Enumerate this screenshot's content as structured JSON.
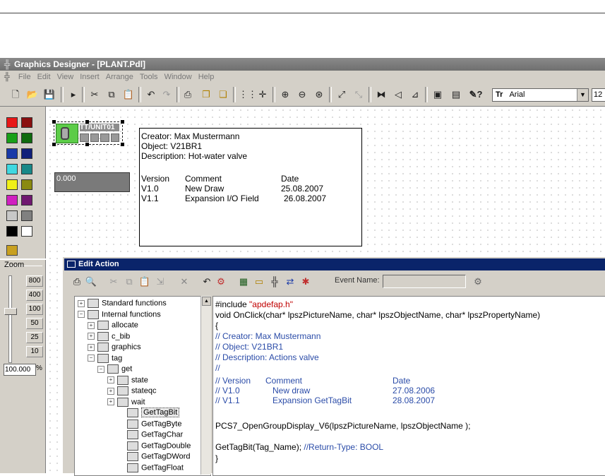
{
  "app": {
    "title": "Graphics Designer - [PLANT.Pdl]"
  },
  "menu": [
    "File",
    "Edit",
    "View",
    "Insert",
    "Arrange",
    "Tools",
    "Window",
    "Help"
  ],
  "toolbar": {
    "font_name": "Arial",
    "font_size": "12"
  },
  "palette": {
    "colors": [
      [
        "#e81818",
        "#8a1010"
      ],
      [
        "#18a018",
        "#0f6b0f"
      ],
      [
        "#1a3aa8",
        "#10207a"
      ],
      [
        "#40d8e0",
        "#188888"
      ],
      [
        "#f0f018",
        "#8a8a10"
      ],
      [
        "#d020c0",
        "#701870"
      ],
      [
        "#c8c8c8",
        "#808080"
      ],
      [
        "#000000",
        "#ffffff"
      ]
    ]
  },
  "zoom": {
    "label": "Zoom",
    "levels": [
      "800",
      "400",
      "100",
      "50",
      "25",
      "10"
    ],
    "value": "100.000",
    "unit": "%"
  },
  "canvas": {
    "valve_tag": "TT/UNIT01",
    "io_value": "0.000",
    "doc": {
      "creator": "Creator: Max Mustermann",
      "object": "Object: V21BR1",
      "description": "Description: Hot-water valve",
      "headers": [
        "Version",
        "Comment",
        "Date"
      ],
      "rows": [
        [
          "V1.0",
          "New Draw",
          "25.08.2007"
        ],
        [
          "V1.1",
          "Expansion I/O Field",
          "26.08.2007"
        ]
      ]
    }
  },
  "edit_action": {
    "title": "Edit Action",
    "event_name_label": "Event Name:",
    "tree": [
      {
        "label": "Standard functions",
        "level": 0,
        "pm": "+"
      },
      {
        "label": "Internal functions",
        "level": 0,
        "pm": "-"
      },
      {
        "label": "allocate",
        "level": 1,
        "pm": "+"
      },
      {
        "label": "c_bib",
        "level": 1,
        "pm": "+"
      },
      {
        "label": "graphics",
        "level": 1,
        "pm": "+"
      },
      {
        "label": "tag",
        "level": 1,
        "pm": "-"
      },
      {
        "label": "get",
        "level": 2,
        "pm": "-"
      },
      {
        "label": "state",
        "level": 3,
        "pm": "+"
      },
      {
        "label": "stateqc",
        "level": 3,
        "pm": "+"
      },
      {
        "label": "wait",
        "level": 3,
        "pm": "+"
      },
      {
        "label": "GetTagBit",
        "level": 4,
        "pm": "",
        "selected": true
      },
      {
        "label": "GetTagByte",
        "level": 4,
        "pm": ""
      },
      {
        "label": "GetTagChar",
        "level": 4,
        "pm": ""
      },
      {
        "label": "GetTagDouble",
        "level": 4,
        "pm": ""
      },
      {
        "label": "GetTagDWord",
        "level": 4,
        "pm": ""
      },
      {
        "label": "GetTagFloat",
        "level": 4,
        "pm": ""
      }
    ],
    "code": {
      "include_kw": "#include ",
      "include_file": "\"apdefap.h\"",
      "signature": "void OnClick(char* lpszPictureName, char* lpszObjectName, char* lpszPropertyName)",
      "open_brace": "{",
      "c_creator": "// Creator: Max Mustermann",
      "c_object": "// Object: V21BR1",
      "c_desc": "// Description: Actions valve",
      "c_blank": "//",
      "c_hdr": [
        "// Version",
        "Comment",
        "Date"
      ],
      "c_rows": [
        [
          "// V1.0",
          "New draw",
          "27.08.2006"
        ],
        [
          "// V1.1",
          "Expansion GetTagBit",
          "28.08.2007"
        ]
      ],
      "call1": "PCS7_OpenGroupDisplay_V6(lpszPictureName, lpszObjectName );",
      "call2": "GetTagBit(Tag_Name); ",
      "call2_comment": "//Return-Type: BOOL",
      "close_brace": "}"
    }
  }
}
